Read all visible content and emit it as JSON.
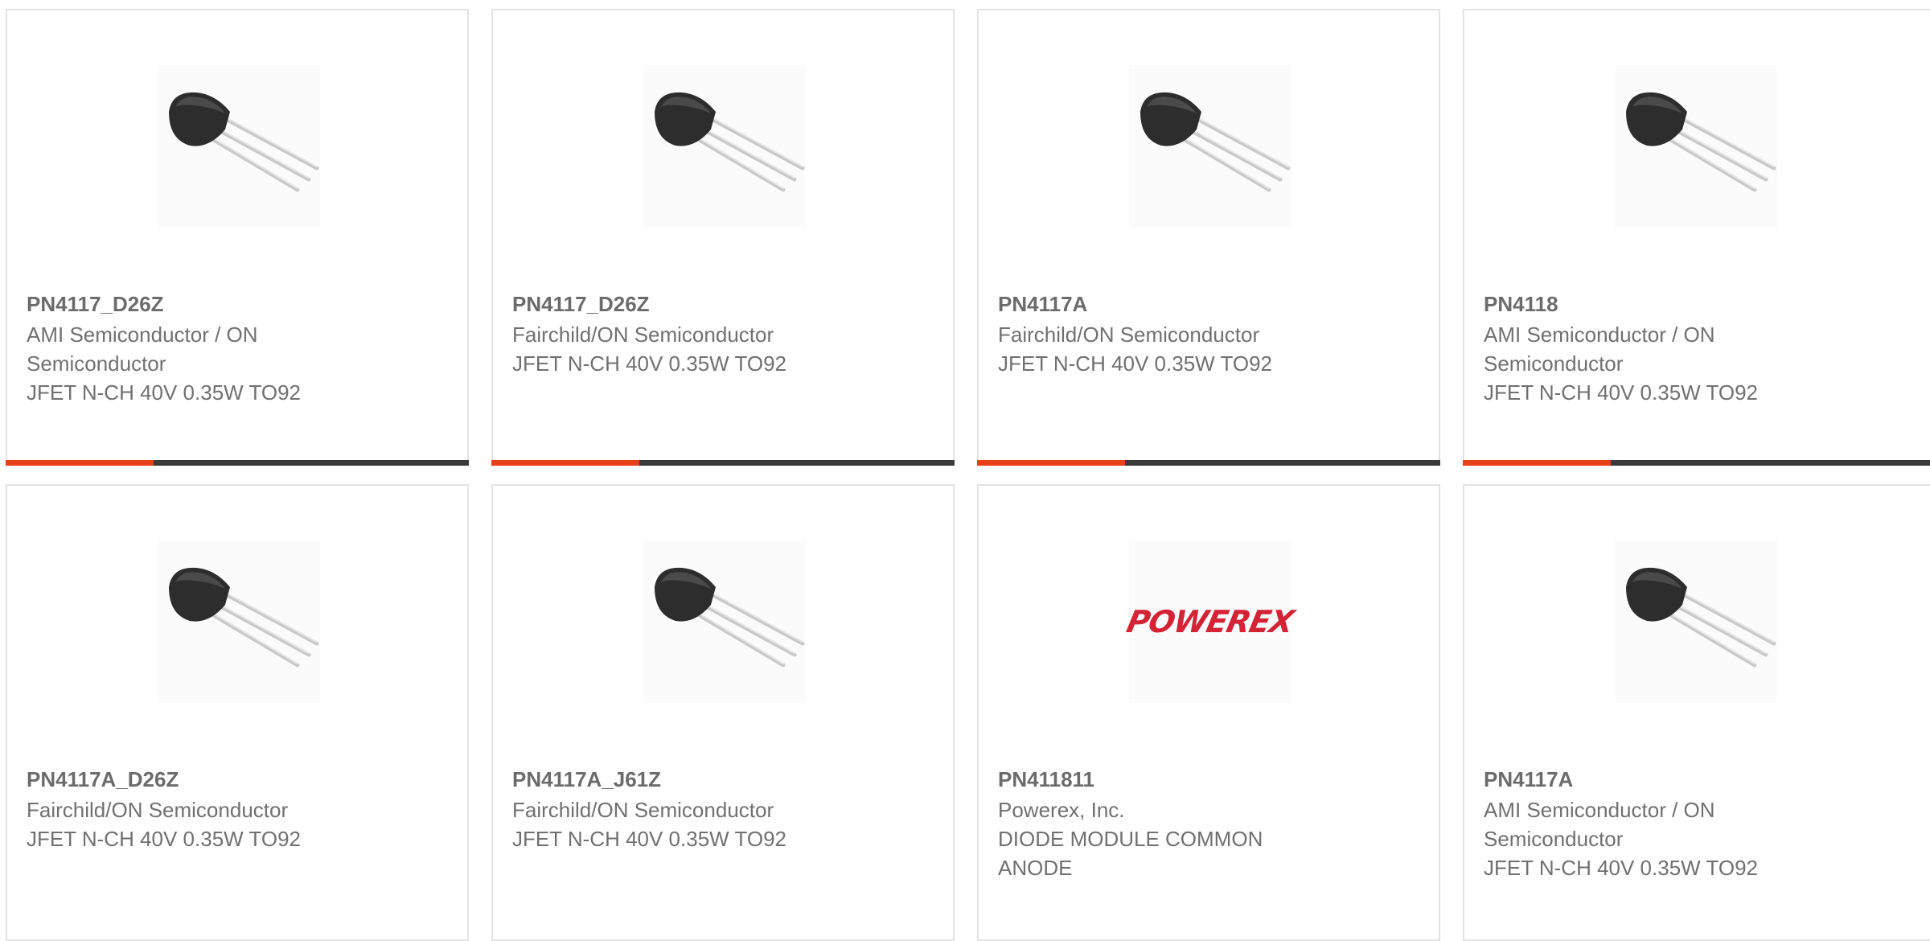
{
  "products": [
    {
      "part_number": "PN4117_D26Z",
      "manufacturer": "AMI Semiconductor / ON Semiconductor",
      "description": "JFET N-CH 40V 0.35W TO92",
      "image": "transistor-to92-image"
    },
    {
      "part_number": "PN4117_D26Z",
      "manufacturer": "Fairchild/ON Semiconductor",
      "description": "JFET N-CH 40V 0.35W TO92",
      "image": "transistor-to92-image"
    },
    {
      "part_number": "PN4117A",
      "manufacturer": "Fairchild/ON Semiconductor",
      "description": "JFET N-CH 40V 0.35W TO92",
      "image": "transistor-to92-image"
    },
    {
      "part_number": "PN4118",
      "manufacturer": "AMI Semiconductor / ON Semiconductor",
      "description": "JFET N-CH 40V 0.35W TO92",
      "image": "transistor-to92-image"
    },
    {
      "part_number": "PN4117A_D26Z",
      "manufacturer": "Fairchild/ON Semiconductor",
      "description": "JFET N-CH 40V 0.35W TO92",
      "image": "transistor-to92-image"
    },
    {
      "part_number": "PN4117A_J61Z",
      "manufacturer": "Fairchild/ON Semiconductor",
      "description": "JFET N-CH 40V 0.35W TO92",
      "image": "transistor-to92-image"
    },
    {
      "part_number": "PN411811",
      "manufacturer": "Powerex, Inc.",
      "description": "DIODE MODULE COMMON ANODE",
      "image": "powerex-logo",
      "logo_text": "POWEREX"
    },
    {
      "part_number": "PN4117A",
      "manufacturer": "AMI Semiconductor / ON Semiconductor",
      "description": "JFET N-CH 40V 0.35W TO92",
      "image": "transistor-to92-image"
    }
  ],
  "colors": {
    "accent": "#e8401c",
    "bar_dark": "#3a3a3a",
    "card_border": "#e3e3e3",
    "text": "#707070",
    "powerex_red": "#d32335"
  }
}
